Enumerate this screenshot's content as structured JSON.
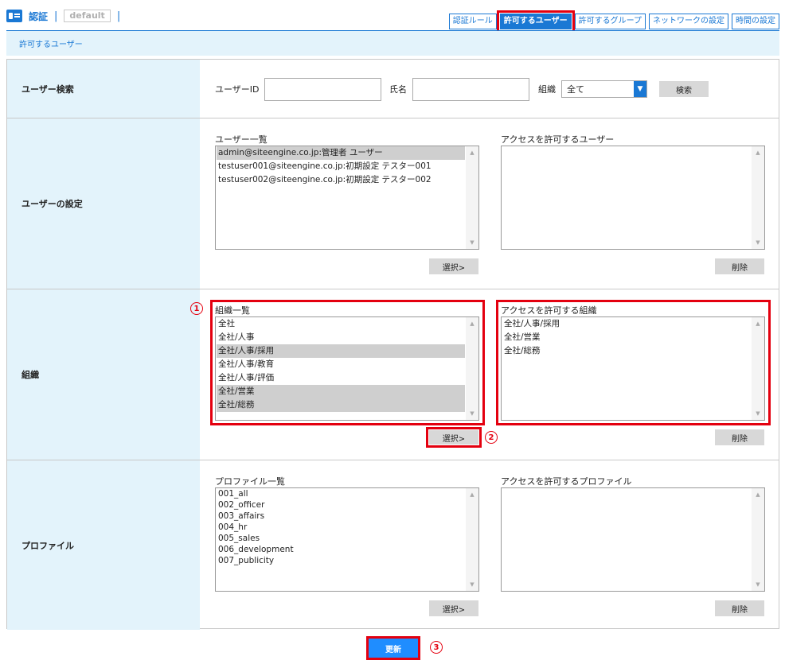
{
  "header": {
    "title": "認証",
    "separator": "|",
    "profile_badge": "default"
  },
  "tabs": [
    {
      "label": "認証ルール",
      "active": false
    },
    {
      "label": "許可するユーザー",
      "active": true
    },
    {
      "label": "許可するグループ",
      "active": false
    },
    {
      "label": "ネットワークの設定",
      "active": false
    },
    {
      "label": "時間の設定",
      "active": false
    }
  ],
  "subtitle": "許可するユーザー",
  "search": {
    "label": "ユーザー検索",
    "user_id_label": "ユーザーID",
    "user_id_value": "",
    "name_label": "氏名",
    "name_value": "",
    "org_label": "組織",
    "org_selected": "全て",
    "search_button": "検索"
  },
  "user_settings": {
    "label": "ユーザーの設定",
    "list_caption": "ユーザー一覧",
    "items": [
      {
        "text": "admin@siteengine.co.jp:管理者 ユーザー",
        "selected": true
      },
      {
        "text": "testuser001@siteengine.co.jp:初期設定 テスター001",
        "selected": false
      },
      {
        "text": "testuser002@siteengine.co.jp:初期設定 テスター002",
        "selected": false
      }
    ],
    "allowed_caption": "アクセスを許可するユーザー",
    "allowed_items": [],
    "select_button": "選択>",
    "delete_button": "削除"
  },
  "organization": {
    "label": "組織",
    "list_caption": "組織一覧",
    "items": [
      {
        "text": "全社",
        "selected": false
      },
      {
        "text": "全社/人事",
        "selected": false
      },
      {
        "text": "全社/人事/採用",
        "selected": true
      },
      {
        "text": "全社/人事/教育",
        "selected": false
      },
      {
        "text": "全社/人事/評価",
        "selected": false
      },
      {
        "text": "全社/営業",
        "selected": true
      },
      {
        "text": "全社/総務",
        "selected": true
      }
    ],
    "allowed_caption": "アクセスを許可する組織",
    "allowed_items": [
      {
        "text": "全社/人事/採用"
      },
      {
        "text": "全社/営業"
      },
      {
        "text": "全社/総務"
      }
    ],
    "select_button": "選択>",
    "delete_button": "削除"
  },
  "profile": {
    "label": "プロファイル",
    "list_caption": "プロファイル一覧",
    "items": [
      {
        "text": "001_all",
        "selected": false
      },
      {
        "text": "002_officer",
        "selected": false
      },
      {
        "text": "003_affairs",
        "selected": false
      },
      {
        "text": "004_hr",
        "selected": false
      },
      {
        "text": "005_sales",
        "selected": false
      },
      {
        "text": "006_development",
        "selected": false
      },
      {
        "text": "007_publicity",
        "selected": false
      }
    ],
    "allowed_caption": "アクセスを許可するプロファイル",
    "allowed_items": [],
    "select_button": "選択>",
    "delete_button": "削除"
  },
  "annotations": {
    "step1": "1",
    "step2": "2",
    "step3": "3"
  },
  "update_button": "更新",
  "colors": {
    "accent": "#1a78d4",
    "highlight": "#e4000f",
    "label_bg": "#e3f3fb",
    "selected_row": "#cfcfcf"
  }
}
